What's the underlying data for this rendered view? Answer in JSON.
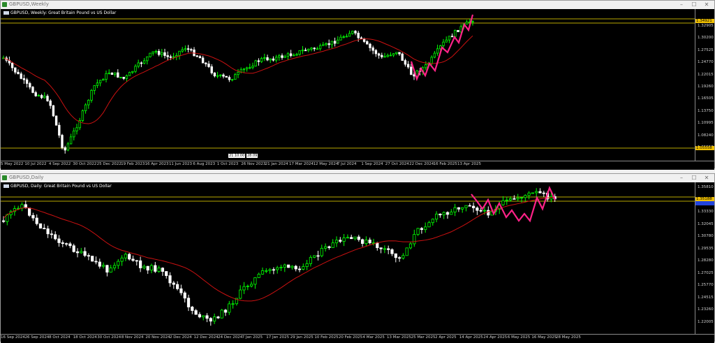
{
  "window1": {
    "title": "GBPUSD,Weekly",
    "chart_label": "GBPUSD, Weekly:  Great Britain Pound vs US Dollar",
    "low_tags": [
      "21.10.00",
      "28.09"
    ],
    "price_tag_top": "1.34921",
    "price_tag_bottom": "1.05558",
    "y_ticks": [
      "1.32905",
      "1.30200",
      "1.27525",
      "1.24770",
      "1.22015",
      "1.19260",
      "1.16505",
      "1.13750",
      "1.10995",
      "1.08240",
      "1.05558"
    ],
    "x_ticks": [
      "5 May 2022",
      "10 Jul 2022",
      "4 Sep 2022",
      "30 Oct 2022",
      "25 Dec 2022",
      "19 Feb 2023",
      "16 Apr 2023",
      "11 Jun 2023",
      "6 Aug 2023",
      "1 Oct 2023",
      "26 Nov 2023",
      "21 Jan 2024",
      "17 Mar 2024",
      "12 May 2024",
      "7 Jul 2024",
      "1 Sep 2024",
      "27 Oct 2024",
      "22 Dec 2024",
      "16 Feb 2025",
      "13 Apr 2025"
    ]
  },
  "window2": {
    "title": "GBPUSD,Daily",
    "chart_label": "GBPUSD, Daily:  Great Britain Pound vs US Dollar",
    "price_tag_top": "1.35188",
    "y_ticks": [
      "1.35810",
      "1.33690",
      "1.33330",
      "1.32045",
      "1.30780",
      "1.29535",
      "1.28280",
      "1.27025",
      "1.25770",
      "1.24515",
      "1.23260",
      "1.22005"
    ],
    "x_ticks": [
      "16 Sep 2024",
      "26 Sep 2024",
      "8 Oct 2024",
      "18 Oct 2024",
      "30 Oct 2024",
      "8 Nov 2024",
      "20 Nov 2024",
      "2 Dec 2024",
      "12 Dec 2024",
      "24 Dec 2024",
      "7 Jan 2025",
      "17 Jan 2025",
      "29 Jan 2025",
      "10 Feb 2025",
      "20 Feb 2025",
      "4 Mar 2025",
      "13 Mar 2025",
      "25 Mar 2025",
      "2 Apr 2025",
      "14 Apr 2025",
      "24 Apr 2025",
      "6 May 2025",
      "16 May 2025",
      "28 May 2025"
    ]
  },
  "window_buttons": {
    "minimize": "–",
    "maximize": "☐",
    "close": "✕"
  },
  "colors": {
    "bull": "#00ff00",
    "bear": "#ffffff",
    "ma": "#cc1111",
    "zigzag": "#ff2288",
    "hline": "#b8a800"
  }
}
